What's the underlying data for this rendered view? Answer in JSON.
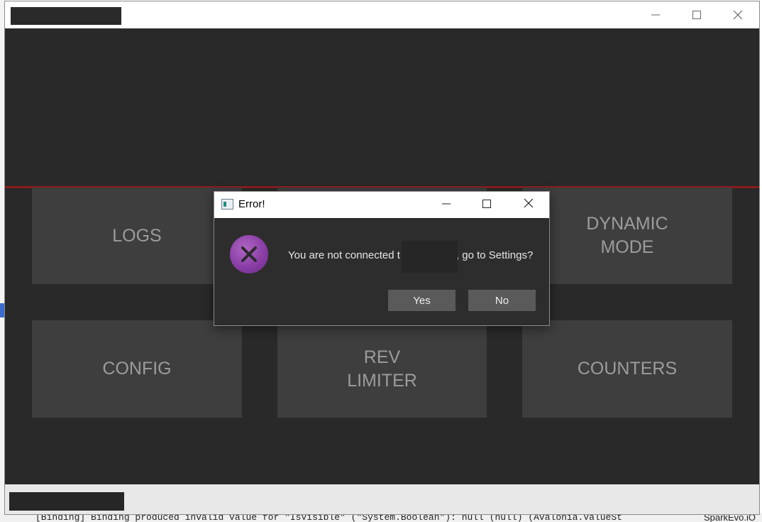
{
  "app": {
    "window_controls": {
      "minimize_icon": "minimize-icon",
      "maximize_icon": "maximize-icon",
      "close_icon": "close-icon"
    },
    "accent_color": "#8b1c1c",
    "tiles": [
      {
        "label": "LOGS"
      },
      {
        "label": "DYNAMIC\nMODE"
      },
      {
        "label": "CONFIG"
      },
      {
        "label": "REV\nLIMITER"
      },
      {
        "label": "COUNTERS"
      }
    ]
  },
  "dialog": {
    "title": "Error!",
    "message_before": "You are not connected t",
    "message_after": ", go to Settings?",
    "icon": "error-x-icon",
    "yes_label": "Yes",
    "no_label": "No"
  },
  "background": {
    "output_line": "[Binding] Binding produced invalid value for \"IsVisible\" (\"System.Boolean\"): null (null) (Avalonia.ValueSt",
    "side_panel_text": "SparkEvo.iO"
  }
}
